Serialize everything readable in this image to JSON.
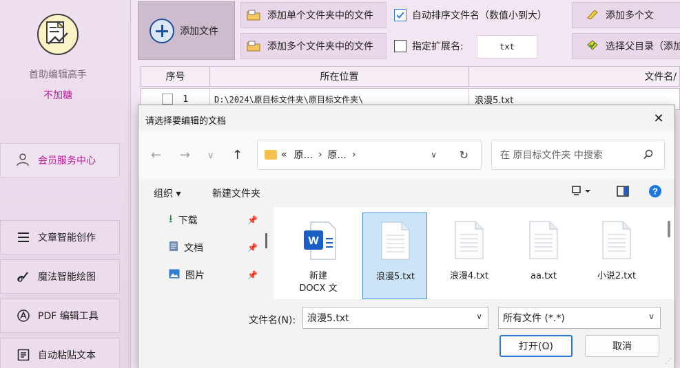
{
  "sidebar": {
    "app_name": "首助编辑高手",
    "app_sub": "不加糖",
    "member_label": "会员服务中心",
    "items": [
      {
        "label": "文章智能创作"
      },
      {
        "label": "魔法智能绘图"
      },
      {
        "label": "PDF 编辑工具"
      },
      {
        "label": "自动粘贴文本"
      }
    ]
  },
  "toolbar": {
    "add_file": "添加文件",
    "add_single_folder": "添加单个文件夹中的文件",
    "add_multi_folder": "添加多个文件夹中的文件",
    "auto_sort": "自动排序文件名（数值小到大）",
    "auto_sort_checked": true,
    "ext_label": "指定扩展名:",
    "ext_value": "txt",
    "right_top": "添加多个文",
    "right_bottom": "选择父目录（添加"
  },
  "table": {
    "columns": [
      "序号",
      "所在位置",
      "文件名/"
    ],
    "row": {
      "index": "1",
      "path": "D:\\2024\\原目标文件夹\\原目标文件夹\\",
      "name": "浪漫5.txt"
    }
  },
  "dialog": {
    "title": "请选择要编辑的文档",
    "address": {
      "prefix": "«",
      "part1": "原...",
      "part2": "原..."
    },
    "search_placeholder": "在 原目标文件夹 中搜索",
    "organize": "组织 ▾",
    "new_folder": "新建文件夹",
    "nav_items": [
      {
        "label": "下载"
      },
      {
        "label": "文档"
      },
      {
        "label": "图片"
      }
    ],
    "files": [
      {
        "name1": "新建",
        "name2": "DOCX 文"
      },
      {
        "name1": "浪漫5.txt",
        "name2": ""
      },
      {
        "name1": "浪漫4.txt",
        "name2": ""
      },
      {
        "name1": "aa.txt",
        "name2": ""
      },
      {
        "name1": "小说2.txt",
        "name2": ""
      }
    ],
    "filename_label": "文件名(N):",
    "filename_value": "浪漫5.txt",
    "filter_value": "所有文件 (*.*)",
    "open_label": "打开(O)",
    "cancel_label": "取消"
  },
  "colors": {
    "accent": "#c0179a",
    "sidebar_bg": "#efe0ef",
    "selection": "#cce4f7",
    "primary_border": "#2a78d6"
  }
}
